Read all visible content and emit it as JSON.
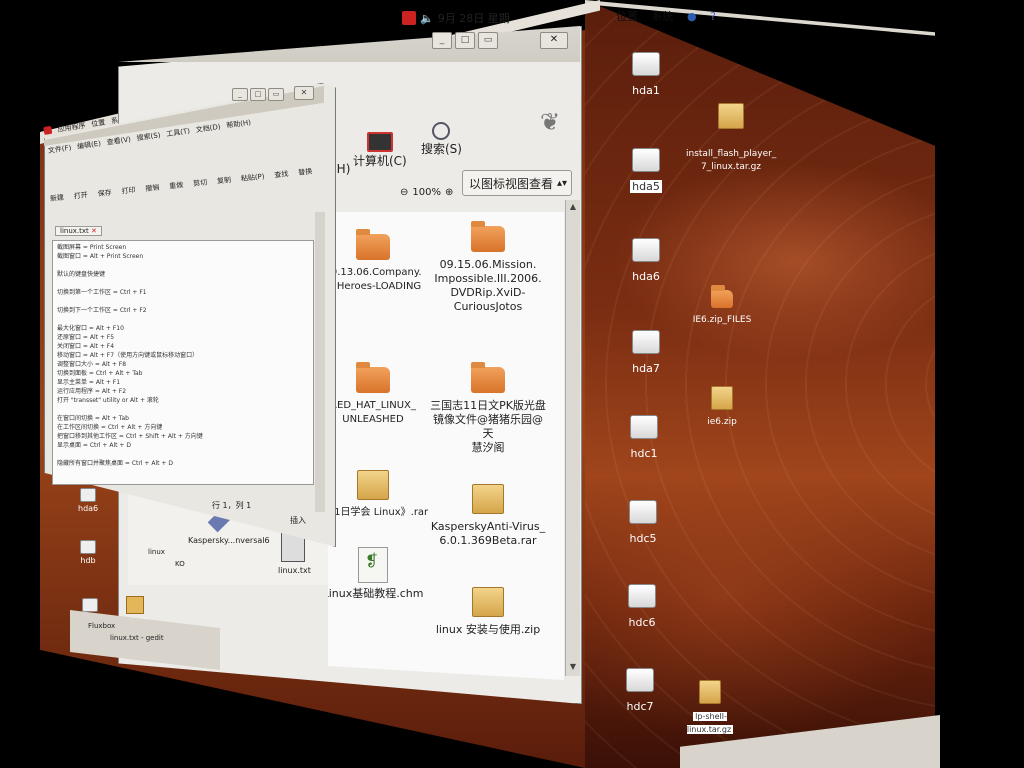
{
  "top_panel": {
    "clock": "9月 28日 星期",
    "menu_right": [
      "位置",
      "系统"
    ],
    "menu_left_small": [
      "应用程序",
      "位置",
      "系统"
    ]
  },
  "nautilus": {
    "toolbar": {
      "share_partial": "共(H)",
      "computer": "计算机(C)",
      "search": "搜索(S)"
    },
    "zoom": "100%",
    "view_mode": "以图标视图查看",
    "files": [
      {
        "name": "09.13.06.Company.\nof.Heroes-LOADING",
        "type": "folder"
      },
      {
        "name": "09.15.06.Mission.\nImpossible.III.2006.\nDVDRip.XviD-\nCuriousJotos",
        "type": "folder"
      },
      {
        "name": "RED_HAT_LINUX_\nUNLEASHED",
        "type": "folder"
      },
      {
        "name": "三国志11日文PK版光盘\n镜像文件@猪猪乐园@天\n慧汐阁",
        "type": "folder"
      },
      {
        "name": "《21日学会 Linux》.rar",
        "type": "package"
      },
      {
        "name": "KasperskyAnti-Virus_\n6.0.1.369Beta.rar",
        "type": "package"
      },
      {
        "name": "Linux基础教程.chm",
        "type": "chm"
      },
      {
        "name": "linux 安装与使用.zip",
        "type": "package"
      }
    ],
    "hidden_row": [
      "Kaspersky...nversal6",
      "linux.txt"
    ],
    "hidden_row_labels": [
      "linux",
      "KO"
    ]
  },
  "gedit": {
    "menu": [
      "文件(F)",
      "编辑(E)",
      "查看(V)",
      "搜索(S)",
      "工具(T)",
      "文档(D)",
      "帮助(H)"
    ],
    "tools": [
      "新建",
      "打开",
      "保存",
      "打印",
      "撤销",
      "重做",
      "剪切",
      "复制",
      "粘贴(P)",
      "查找",
      "替换"
    ],
    "tab": "linux.txt",
    "lines": [
      "截图屏幕 = Print Screen",
      "截图窗口 = Alt + Print Screen",
      "",
      "默认的键盘快捷键",
      "",
      "切换到第一个工作区 = Ctrl + F1",
      "",
      "切换到下一个工作区 = Ctrl + F2",
      "",
      "最大化窗口 = Alt + F10",
      "还原窗口 = Alt + F5",
      "关闭窗口 = Alt + F4",
      "移动窗口 = Alt + F7（使用方向键或鼠标移动窗口）",
      "调整窗口大小 = Alt + F8",
      "切换到面板 = Ctrl + Alt + Tab",
      "显示主菜单 = Alt + F1",
      "运行应用程序 = Alt + F2",
      "打开 \"transset\" utility or Alt + 滚轮",
      "",
      "在窗口间切换 = Alt + Tab",
      "在工作区间切换 = Ctrl + Alt + 方向键",
      "把窗口移到其他工作区 = Ctrl + Shift + Alt + 方向键",
      "显示桌面 = Ctrl + Alt + D",
      "",
      "隐藏所有窗口并聚焦桌面 = Ctrl + Alt + D"
    ],
    "status_position": "行 1，列 1",
    "status_mode": "插入"
  },
  "left_face_icons": [
    {
      "label": "hda6",
      "type": "drive"
    },
    {
      "label": "hdb",
      "type": "drive"
    },
    {
      "label": "hdc",
      "type": "drive"
    },
    {
      "label": "ie6.zip",
      "type": "package"
    }
  ],
  "left_taskbar": [
    "Fluxbox",
    "linux.txt - gedit"
  ],
  "desktop_right": [
    {
      "label": "hda1",
      "type": "drive",
      "selected": false
    },
    {
      "label": "hda5",
      "type": "drive",
      "selected": true
    },
    {
      "label": "hda6",
      "type": "drive",
      "selected": false
    },
    {
      "label": "hda7",
      "type": "drive",
      "selected": false
    },
    {
      "label": "hdc1",
      "type": "drive",
      "selected": false
    },
    {
      "label": "hdc5",
      "type": "drive",
      "selected": false
    },
    {
      "label": "hdc6",
      "type": "drive",
      "selected": false
    },
    {
      "label": "hdc7",
      "type": "drive",
      "selected": false
    },
    {
      "label": "install_flash_player_\n7_linux.tar.gz",
      "type": "package",
      "selected": false
    },
    {
      "label": "IE6.zip_FILES",
      "type": "folder",
      "selected": false
    },
    {
      "label": "ie6.zip",
      "type": "package",
      "selected": false
    },
    {
      "label": "lp-shell-linux.tar.gz",
      "type": "package",
      "selected": false
    }
  ],
  "colors": {
    "wallpaper": "#7a2d12",
    "panel": "#e6e2da",
    "folder": "#e08a40",
    "accent": "#c22222"
  }
}
